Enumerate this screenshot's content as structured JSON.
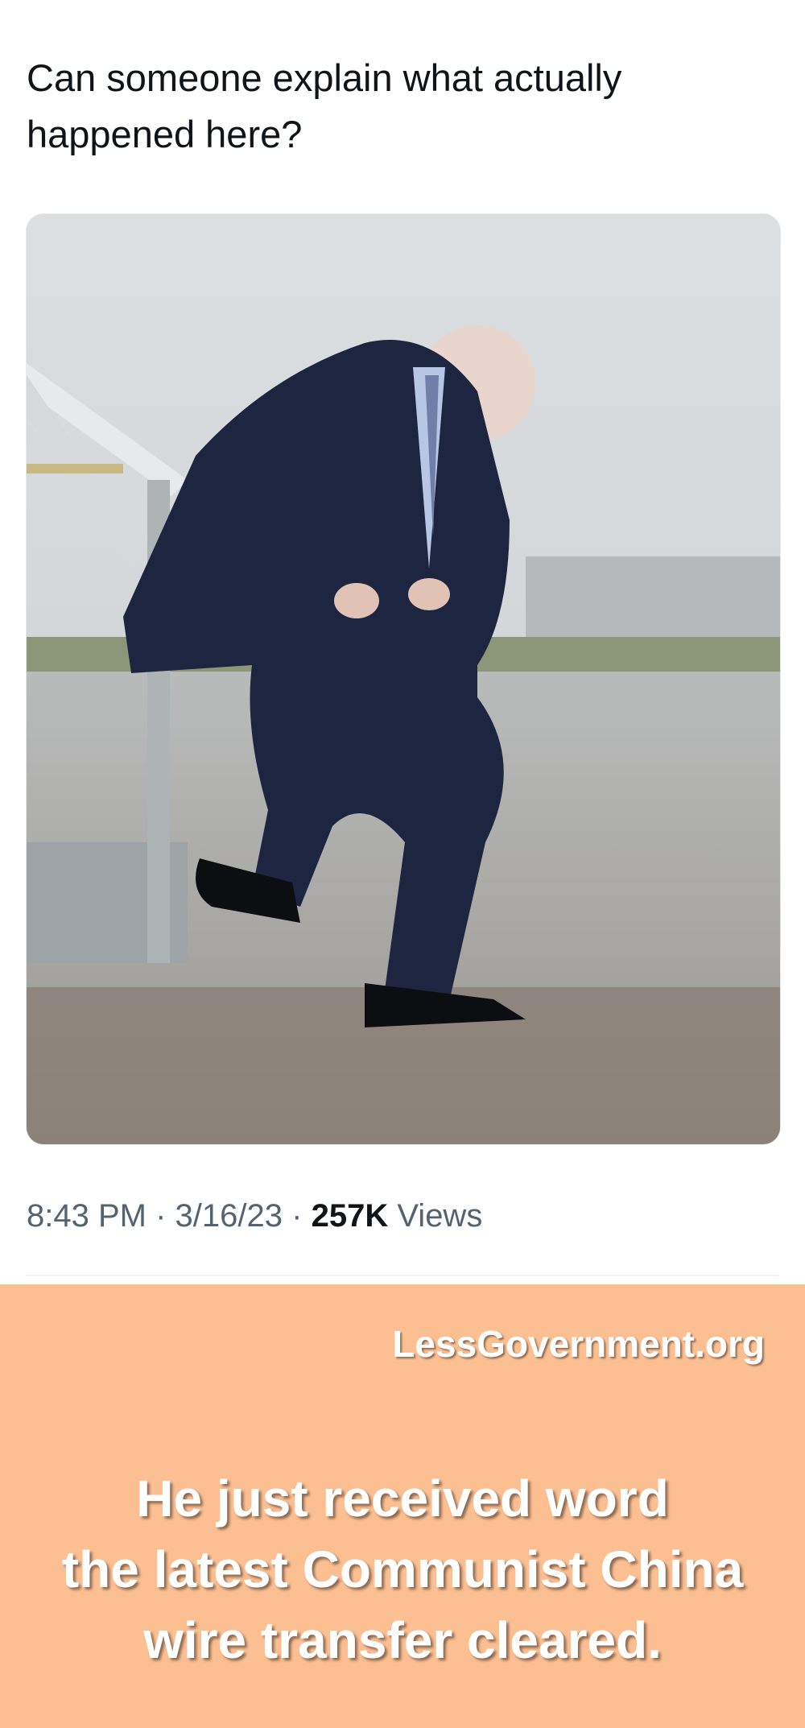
{
  "tweet": {
    "text": "Can someone explain what actually\nhappened here?",
    "time": "8:43 PM",
    "date": "3/16/23",
    "views_count": "257K",
    "views_label": "Views",
    "separator": "·"
  },
  "overlay": {
    "site": "LessGovernment.org",
    "caption_lines": [
      "He just received word",
      "the latest Communist China",
      "wire transfer cleared."
    ]
  },
  "colors": {
    "panel_background": "#fcbf92",
    "tweet_text": "#0f1419",
    "meta_text": "#536471"
  }
}
